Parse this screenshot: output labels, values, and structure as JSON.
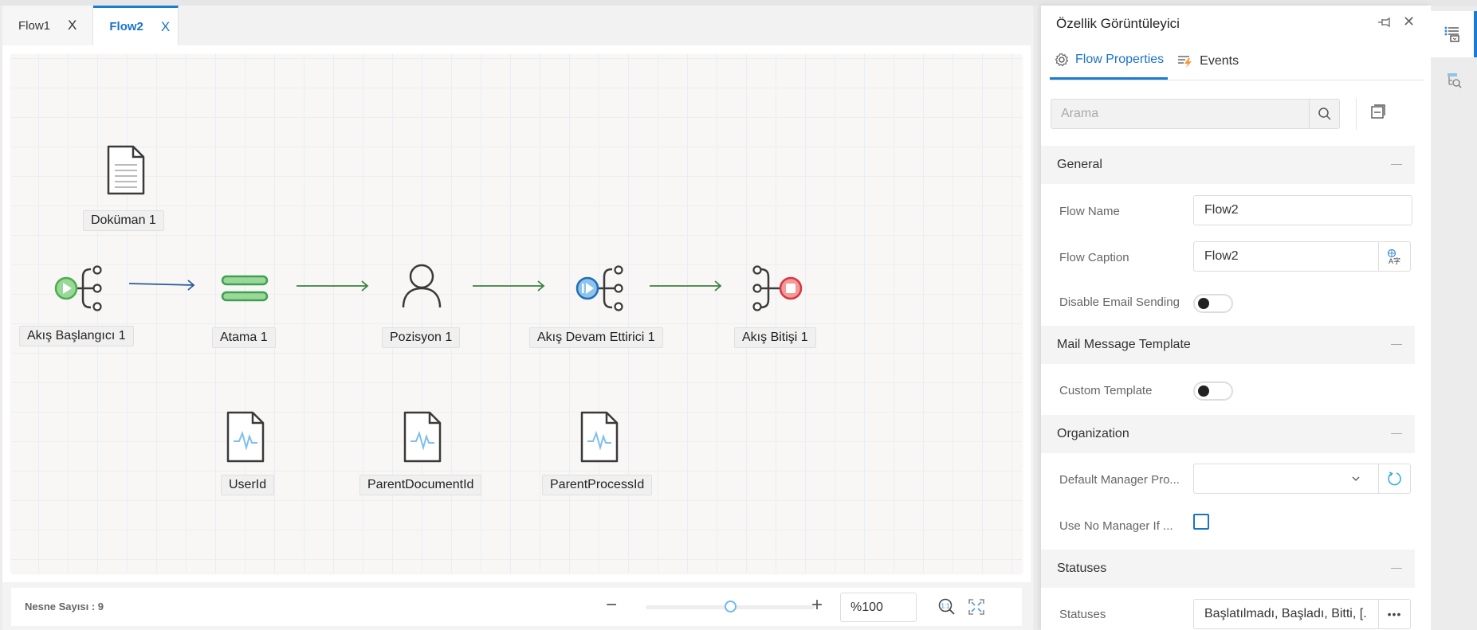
{
  "tabs": [
    {
      "label": "Flow1",
      "close": "X",
      "active": false
    },
    {
      "label": "Flow2",
      "close": "X",
      "active": true
    }
  ],
  "canvas": {
    "nodes": [
      {
        "id": "doc1",
        "label": "Doküman 1",
        "icon": "document-icon"
      },
      {
        "id": "start1",
        "label": "Akış Başlangıcı 1",
        "icon": "flow-start-icon"
      },
      {
        "id": "assign1",
        "label": "Atama 1",
        "icon": "assignment-icon"
      },
      {
        "id": "pos1",
        "label": "Pozisyon 1",
        "icon": "user-icon"
      },
      {
        "id": "cont1",
        "label": "Akış Devam Ettirici 1",
        "icon": "flow-continue-icon"
      },
      {
        "id": "end1",
        "label": "Akış Bitişi 1",
        "icon": "flow-end-icon"
      },
      {
        "id": "var1",
        "label": "UserId",
        "icon": "variable-file-icon"
      },
      {
        "id": "var2",
        "label": "ParentDocumentId",
        "icon": "variable-file-icon"
      },
      {
        "id": "var3",
        "label": "ParentProcessId",
        "icon": "variable-file-icon"
      }
    ],
    "edges": [
      {
        "from": "start1",
        "to": "assign1",
        "color": "#2a5a9a"
      },
      {
        "from": "assign1",
        "to": "pos1",
        "color": "#3f7f3f"
      },
      {
        "from": "pos1",
        "to": "cont1",
        "color": "#3f7f3f"
      },
      {
        "from": "cont1",
        "to": "end1",
        "color": "#3f7f3f"
      }
    ]
  },
  "footer": {
    "object_count": "Nesne Sayısı : 9",
    "zoom_minus": "−",
    "zoom_plus": "+",
    "zoom_value": "%100",
    "zoom_slider_fraction": 0.5
  },
  "panel": {
    "title": "Özellik Görüntüleyici",
    "tabs": [
      {
        "label": "Flow Properties",
        "active": true
      },
      {
        "label": "Events",
        "active": false
      }
    ],
    "search_placeholder": "Arama",
    "sections": [
      {
        "title": "General",
        "rows": [
          {
            "label": "Flow Name",
            "value": "Flow2"
          },
          {
            "label": "Flow Caption",
            "value": "Flow2"
          },
          {
            "label": "Disable Email Sending",
            "value": false
          }
        ]
      },
      {
        "title": "Mail Message Template",
        "rows": [
          {
            "label": "Custom Template",
            "value": false
          }
        ]
      },
      {
        "title": "Organization",
        "rows": [
          {
            "label": "Default Manager Pro...",
            "value": ""
          },
          {
            "label": "Use No Manager If ...",
            "value": false
          }
        ]
      },
      {
        "title": "Statuses",
        "rows": [
          {
            "label": "Statuses",
            "value": "Başlatılmadı, Başladı, Bitti, [."
          }
        ]
      }
    ]
  },
  "colors": {
    "accent": "#1a7bd2",
    "start_green": "#4cae4c",
    "continue_blue": "#1f6fb8",
    "end_red": "#d9363e",
    "edge_green": "#3f7f3f",
    "edge_blue": "#2a5a9a"
  }
}
